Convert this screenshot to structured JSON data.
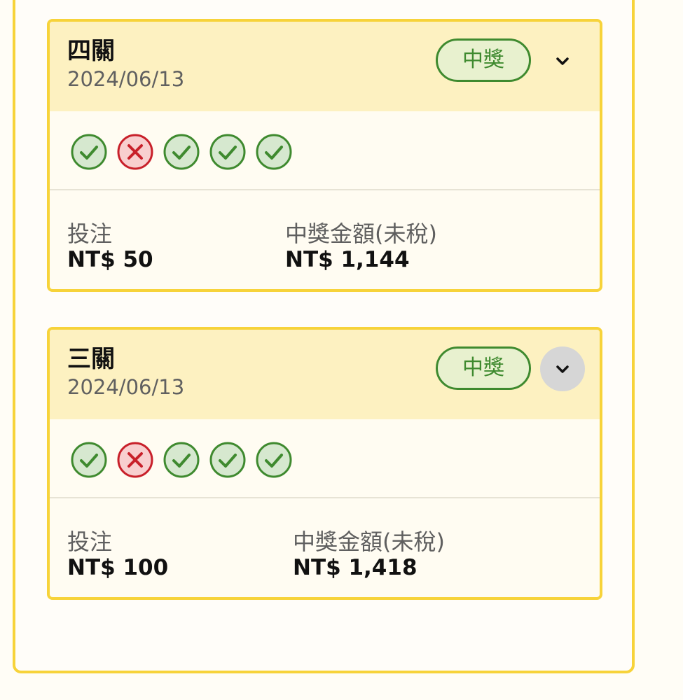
{
  "cards": [
    {
      "title": "四關",
      "date": "2024/06/13",
      "status": "中獎",
      "results": [
        "check-icon",
        "cross-icon",
        "check-icon",
        "check-icon",
        "check-icon"
      ],
      "stake_label": "投注",
      "stake_value": "NT$ 50",
      "prize_label": "中獎金額(未稅)",
      "prize_value": "NT$ 1,144"
    },
    {
      "title": "三關",
      "date": "2024/06/13",
      "status": "中獎",
      "results": [
        "check-icon",
        "cross-icon",
        "check-icon",
        "check-icon",
        "check-icon"
      ],
      "stake_label": "投注",
      "stake_value": "NT$ 100",
      "prize_label": "中獎金額(未稅)",
      "prize_value": "NT$ 1,418"
    }
  ],
  "colors": {
    "card_border": "#f7d33a",
    "header_bg": "#fdf1c1",
    "win_green": "#3f8a2f",
    "loss_red": "#c8202a"
  }
}
